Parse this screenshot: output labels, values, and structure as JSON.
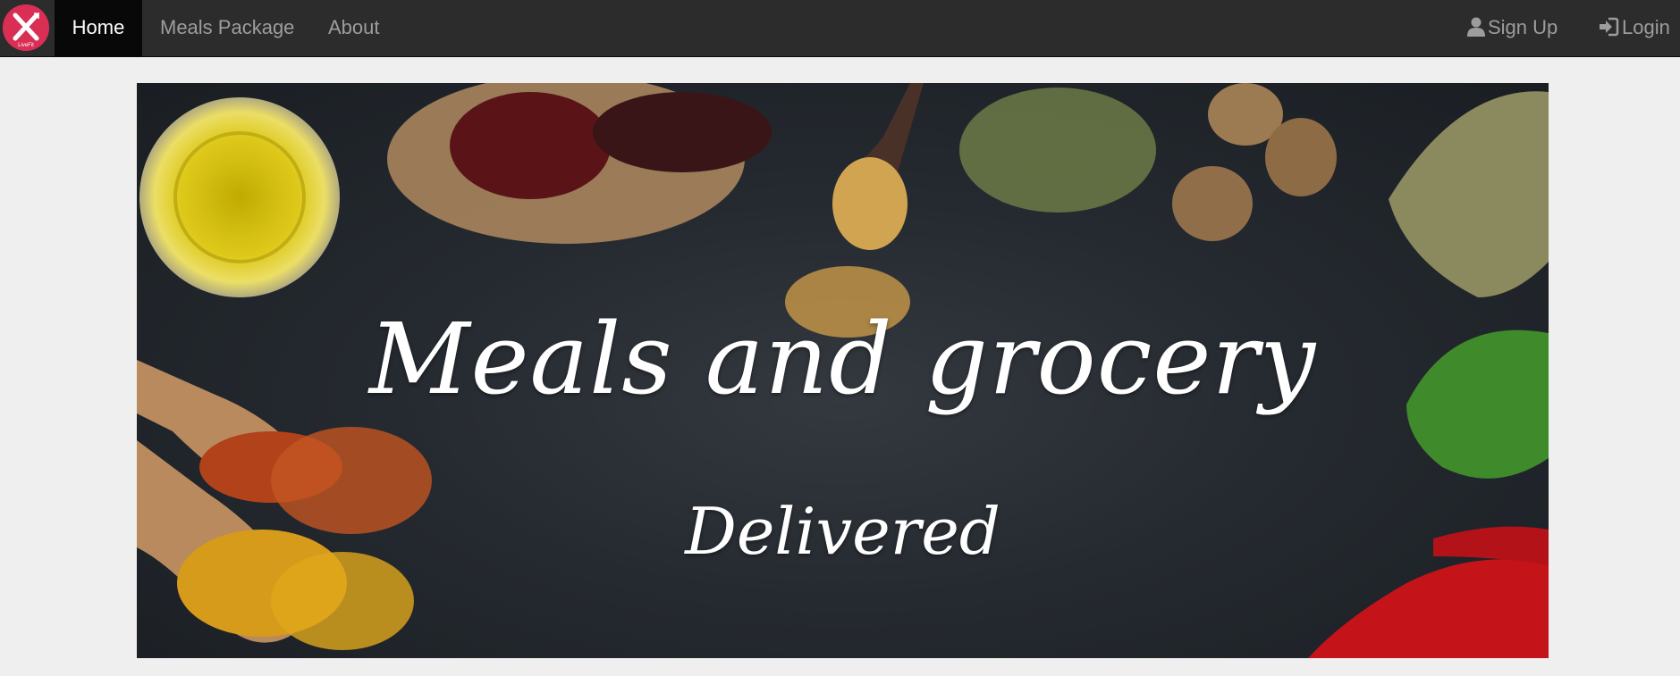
{
  "navbar": {
    "logo_text": "LiveFit",
    "links": [
      {
        "label": "Home",
        "active": true
      },
      {
        "label": "Meals Package",
        "active": false
      },
      {
        "label": "About",
        "active": false
      }
    ],
    "right": {
      "signup_label": "Sign Up",
      "signup_icon": "user-icon",
      "login_label": "Login",
      "login_icon": "log-in-icon"
    }
  },
  "hero": {
    "title": "Meals and grocery",
    "subtitle": "Delivered",
    "image": "spices-on-slate-background"
  },
  "colors": {
    "navbar_bg": "#2c2c2c",
    "active_tab_bg": "#080808",
    "logo_red": "#d92f55",
    "page_bg": "#efefef"
  }
}
